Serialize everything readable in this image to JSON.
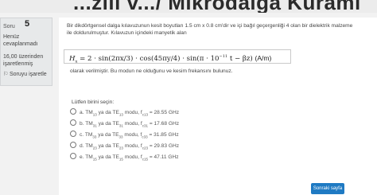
{
  "banner": {
    "title": "...zlil v.../ Mikrodalga Kuramı"
  },
  "question_info": {
    "label": "Soru",
    "number": "5",
    "status": "Henüz cevaplanmadı",
    "marks": "16,00 üzerinden işaretlenmiş",
    "flag_label": "Soruyu işaretle"
  },
  "question": {
    "prompt": "Bir dikdörtgensel dalga kılavuzunun kesit boyutları 1.5 cm x 0.8 cm'dir ve içi bağıl geçergenliği 4 olan bir dielektrik malzeme ile doldurulmuştur. Kılavuzun içindeki manyetik alan",
    "formula": {
      "lhs": "H",
      "lhs_sub": "x",
      "rhs_a": "= 2 · sin(2πx/3) · cos(45πy/4) · sin(π · 10",
      "exponent": "−11",
      "rhs_b": "t − βz)",
      "unit": "(A/m)"
    },
    "description": "olarak verilmiştir. Bu modun ne olduğunu ve kesim frekansını bulunuz.",
    "choose_label": "Lütfen birini seçin:",
    "options": [
      {
        "letter": "a.",
        "text_pre": "TM",
        "mode_sub": "13",
        "text_mid": " ya da TE",
        "mode_sub2": "13",
        "text_post": " modu, f",
        "fc_sub": "c13",
        "value": " = 28.55 GHz"
      },
      {
        "letter": "b.",
        "text_pre": "TM",
        "mode_sub": "31",
        "text_mid": " ya da TE",
        "mode_sub2": "31",
        "text_post": " modu, f",
        "fc_sub": "c31",
        "value": " = 17.68 GHz"
      },
      {
        "letter": "c.",
        "text_pre": "TM",
        "mode_sub": "33",
        "text_mid": " ya da TE",
        "mode_sub2": "33",
        "text_post": " modu, f",
        "fc_sub": "c33",
        "value": " = 31.85 GHz"
      },
      {
        "letter": "d.",
        "text_pre": "TM",
        "mode_sub": "23",
        "text_mid": " ya da TE",
        "mode_sub2": "23",
        "text_post": " modu, f",
        "fc_sub": "c23",
        "value": " = 29.83 GHz"
      },
      {
        "letter": "e.",
        "text_pre": "TM",
        "mode_sub": "15",
        "text_mid": " ya da TE",
        "mode_sub2": "15",
        "text_post": " modu, f",
        "fc_sub": "c15",
        "value": " = 47.11 GHz"
      }
    ]
  },
  "navigation": {
    "next_label": "Sonraki sayfa"
  }
}
